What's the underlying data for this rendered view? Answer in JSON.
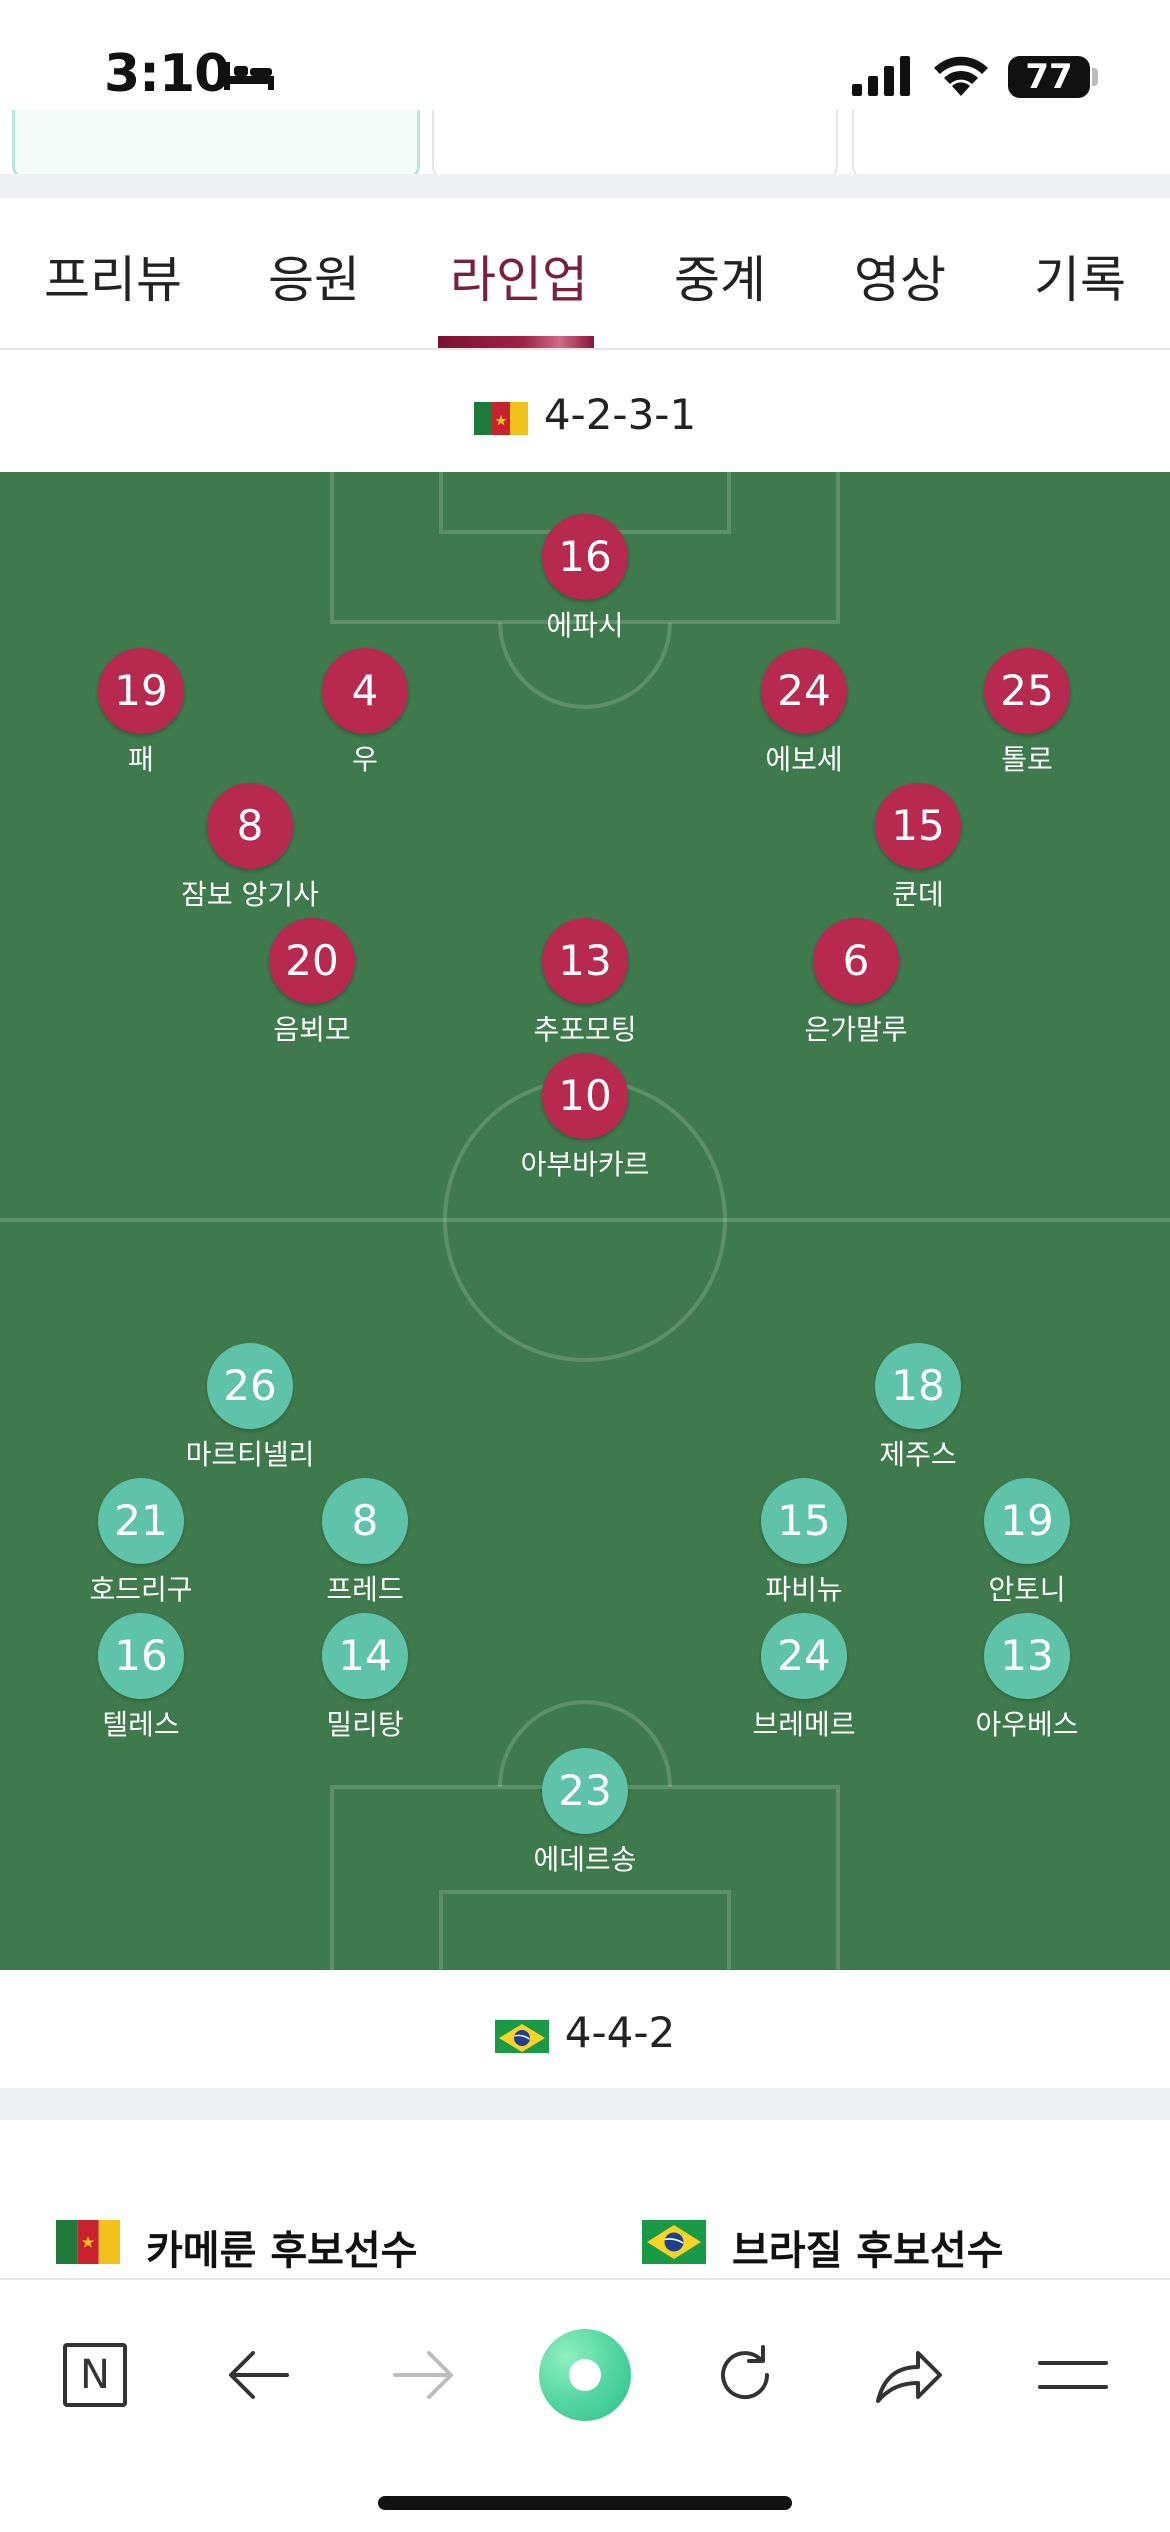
{
  "status_bar": {
    "time": "3:10",
    "battery": "77"
  },
  "tabs": [
    {
      "label": "프리뷰",
      "active": false
    },
    {
      "label": "응원",
      "active": false
    },
    {
      "label": "라인업",
      "active": true
    },
    {
      "label": "중계",
      "active": false
    },
    {
      "label": "영상",
      "active": false
    },
    {
      "label": "기록",
      "active": false
    }
  ],
  "home_team": {
    "formation": "4-2-3-1",
    "flag": "cameroon-flag",
    "players": [
      {
        "number": "16",
        "name": "에파시"
      },
      {
        "number": "19",
        "name": "패"
      },
      {
        "number": "4",
        "name": "우"
      },
      {
        "number": "24",
        "name": "에보세"
      },
      {
        "number": "25",
        "name": "톨로"
      },
      {
        "number": "8",
        "name": "잠보 앙기사"
      },
      {
        "number": "15",
        "name": "쿤데"
      },
      {
        "number": "20",
        "name": "음뵈모"
      },
      {
        "number": "13",
        "name": "추포모팅"
      },
      {
        "number": "6",
        "name": "은가말루"
      },
      {
        "number": "10",
        "name": "아부바카르"
      }
    ]
  },
  "away_team": {
    "formation": "4-4-2",
    "flag": "brazil-flag",
    "players": [
      {
        "number": "26",
        "name": "마르티넬리"
      },
      {
        "number": "18",
        "name": "제주스"
      },
      {
        "number": "21",
        "name": "호드리구"
      },
      {
        "number": "8",
        "name": "프레드"
      },
      {
        "number": "15",
        "name": "파비뉴"
      },
      {
        "number": "19",
        "name": "안토니"
      },
      {
        "number": "16",
        "name": "텔레스"
      },
      {
        "number": "14",
        "name": "밀리탕"
      },
      {
        "number": "24",
        "name": "브레메르"
      },
      {
        "number": "13",
        "name": "아우베스"
      },
      {
        "number": "23",
        "name": "에데르송"
      }
    ]
  },
  "subs": {
    "home_title": "카메룬 후보선수",
    "away_title": "브라질 후보선수"
  },
  "bottom_nav": {
    "logo": "N",
    "items": [
      "n-logo-icon",
      "back-arrow-icon",
      "forward-arrow-icon",
      "green-dot-icon",
      "refresh-icon",
      "share-icon",
      "menu-icon"
    ]
  },
  "colors": {
    "pitch": "#3f7a4d",
    "home_badge": "#b8294f",
    "away_badge": "#5ec3a9",
    "active_tab": "#7b1f3c"
  }
}
